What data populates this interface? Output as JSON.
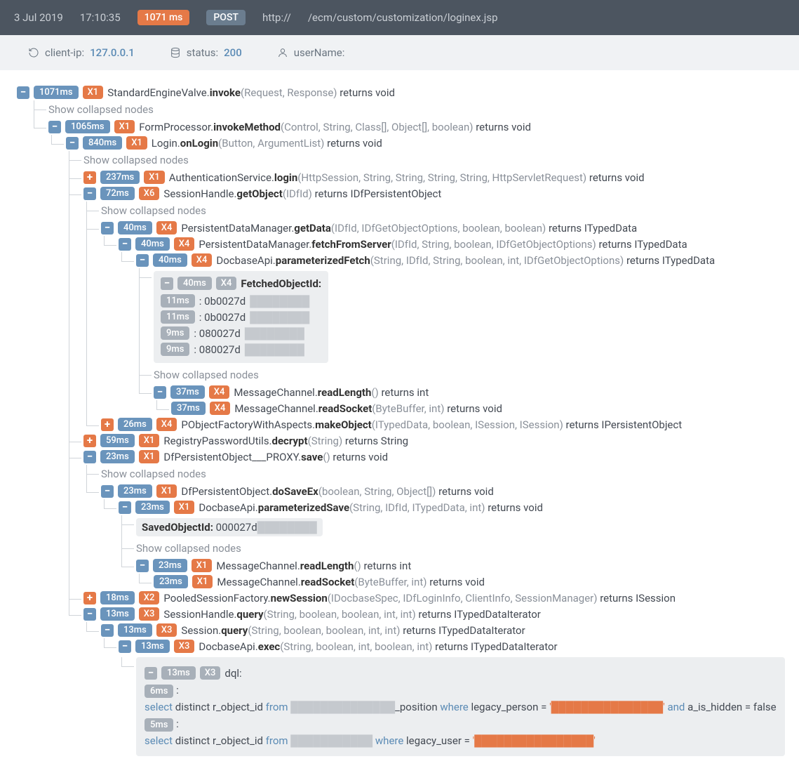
{
  "header": {
    "date": "3 Jul 2019",
    "time": "17:10:35",
    "duration": "1071 ms",
    "method": "POST",
    "proto": "http://",
    "path": "/ecm/custom/customization/loginex.jsp"
  },
  "sub": {
    "clientip_label": "client-ip:",
    "clientip_value": "127.0.0.1",
    "status_label": "status:",
    "status_value": "200",
    "username_label": "userName:"
  },
  "collapsed": "Show collapsed nodes",
  "n": {
    "root": {
      "ms": "1071ms",
      "x": "X1",
      "cls": "StandardEngineValve.",
      "method": "invoke",
      "args": "(Request, Response)",
      "ret": " returns void"
    },
    "fp": {
      "ms": "1065ms",
      "x": "X1",
      "cls": "FormProcessor.",
      "method": "invokeMethod",
      "args": "(Control, String, Class[], Object[], boolean)",
      "ret": " returns void"
    },
    "login": {
      "ms": "840ms",
      "x": "X1",
      "cls": "Login.",
      "method": "onLogin",
      "args": "(Button, ArgumentList)",
      "ret": " returns void"
    },
    "auth": {
      "ms": "237ms",
      "x": "X1",
      "cls": "AuthenticationService.",
      "method": "login",
      "args": "(HttpSession, String, String, String, String, HttpServletRequest)",
      "ret": " returns void"
    },
    "sh": {
      "ms": "72ms",
      "x": "X6",
      "cls": "SessionHandle.",
      "method": "getObject",
      "args": "(IDfId)",
      "ret": " returns IDfPersistentObject"
    },
    "pdm1": {
      "ms": "40ms",
      "x": "X4",
      "cls": "PersistentDataManager.",
      "method": "getData",
      "args": "(IDfId, IDfGetObjectOptions, boolean, boolean)",
      "ret": " returns ITypedData"
    },
    "pdm2": {
      "ms": "40ms",
      "x": "X4",
      "cls": "PersistentDataManager.",
      "method": "fetchFromServer",
      "args": "(IDfId, String, boolean, IDfGetObjectOptions)",
      "ret": " returns ITypedData"
    },
    "dapi": {
      "ms": "40ms",
      "x": "X4",
      "cls": "DocbaseApi.",
      "method": "parameterizedFetch",
      "args": "(String, IDfId, String, boolean, int, IDfGetObjectOptions)",
      "ret": " returns ITypedData"
    },
    "fetched": {
      "ms": "40ms",
      "x": "X4",
      "title": "FetchedObjectId:",
      "rows": [
        {
          "ms": "11ms",
          "v": ": 0b0027d"
        },
        {
          "ms": "11ms",
          "v": ": 0b0027d"
        },
        {
          "ms": "9ms",
          "v": ": 080027d"
        },
        {
          "ms": "9ms",
          "v": ": 080027d"
        }
      ]
    },
    "mc_rl": {
      "ms": "37ms",
      "x": "X4",
      "cls": "MessageChannel.",
      "method": "readLength",
      "args": "()",
      "ret": " returns int"
    },
    "mc_rs": {
      "ms": "37ms",
      "x": "X4",
      "cls": "MessageChannel.",
      "method": "readSocket",
      "args": "(ByteBuffer, int)",
      "ret": " returns void"
    },
    "pof": {
      "ms": "26ms",
      "x": "X4",
      "cls": "PObjectFactoryWithAspects.",
      "method": "makeObject",
      "args": "(ITypedData, boolean, ISession, ISession)",
      "ret": " returns IPersistentObject"
    },
    "rpu": {
      "ms": "59ms",
      "x": "X1",
      "cls": "RegistryPasswordUtils.",
      "method": "decrypt",
      "args": "(String)",
      "ret": " returns String"
    },
    "dfpo": {
      "ms": "23ms",
      "x": "X1",
      "cls": "DfPersistentObject___PROXY.",
      "method": "save",
      "args": "()",
      "ret": " returns void"
    },
    "dfpose": {
      "ms": "23ms",
      "x": "X1",
      "cls": "DfPersistentObject.",
      "method": "doSaveEx",
      "args": "(boolean, String, Object[])",
      "ret": " returns void"
    },
    "dps": {
      "ms": "23ms",
      "x": "X1",
      "cls": "DocbaseApi.",
      "method": "parameterizedSave",
      "args": "(String, IDfId, ITypedData, int)",
      "ret": " returns void"
    },
    "saved": {
      "title": "SavedObjectId:",
      "v": " 000027d"
    },
    "mc_rl2": {
      "ms": "23ms",
      "x": "X1",
      "cls": "MessageChannel.",
      "method": "readLength",
      "args": "()",
      "ret": " returns int"
    },
    "mc_rs2": {
      "ms": "23ms",
      "x": "X1",
      "cls": "MessageChannel.",
      "method": "readSocket",
      "args": "(ByteBuffer, int)",
      "ret": " returns void"
    },
    "psf": {
      "ms": "18ms",
      "x": "X2",
      "cls": "PooledSessionFactory.",
      "method": "newSession",
      "args": "(IDocbaseSpec, IDfLoginInfo, ClientInfo, SessionManager)",
      "ret": " returns ISession"
    },
    "shq": {
      "ms": "13ms",
      "x": "X3",
      "cls": "SessionHandle.",
      "method": "query",
      "args": "(String, boolean, boolean, int, int)",
      "ret": " returns ITypedDataIterator"
    },
    "sq": {
      "ms": "13ms",
      "x": "X3",
      "cls": "Session.",
      "method": "query",
      "args": "(String, boolean, boolean, int, int)",
      "ret": " returns ITypedDataIterator"
    },
    "daex": {
      "ms": "13ms",
      "x": "X3",
      "cls": "DocbaseApi.",
      "method": "exec",
      "args": "(String, boolean, int, boolean, int)",
      "ret": " returns ITypedDataIterator"
    },
    "dql": {
      "ms": "13ms",
      "x": "X3",
      "title": "dql:",
      "q1ms": "6ms",
      "q1": {
        "p1": "select",
        "p2": " distinct r_object_id ",
        "p3": "from",
        "p4b": "_position ",
        "p5": "where",
        "p6": " legacy_person = ",
        "p8": " and",
        "p9": " a_is_hidden = false"
      },
      "q2ms": "5ms",
      "q2": {
        "p1": "select",
        "p2": " distinct r_object_id ",
        "p3": "from",
        "p5": "where",
        "p6": " legacy_user = "
      }
    }
  }
}
